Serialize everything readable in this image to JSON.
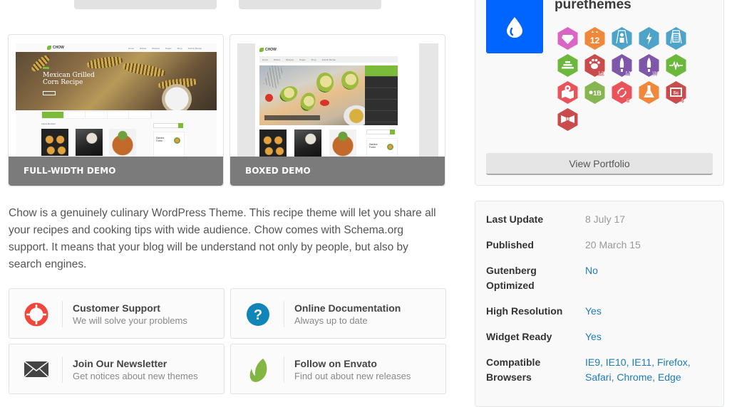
{
  "top_buttons": [
    "",
    ""
  ],
  "demos": [
    {
      "label": "FULL-WIDTH DEMO",
      "thumb": {
        "logo": "CHOW",
        "nav": [
          "Home",
          "Dishes",
          "Recipes",
          "Pages",
          "Shop",
          "Submit Recipe"
        ],
        "hero_title_line1": "Mexican Grilled",
        "hero_title_line2": "Corn Recipe",
        "section_title": "Latest Recipes",
        "author_name_line1": "Sandra",
        "author_name_line2": "Fortin"
      }
    },
    {
      "label": "BOXED DEMO",
      "thumb": {
        "logo": "CHOW",
        "nav": [
          "Home",
          "Dishes",
          "Recipes",
          "Pages",
          "Shop",
          "Submit Recipe"
        ],
        "hero_caption": "Avocado Melon Salad With Lime Vinaigrette",
        "author_name_line1": "Sandra",
        "author_name_line2": "Fortin"
      }
    }
  ],
  "description": "Chow is a genuinely culinary WordPress Theme. This recipe theme will let you share all your recipes and cooking tips with wide audience. Chow comes with Schema.org support. It means that your blog will be understand not only by people, but also by search engines.",
  "features": [
    {
      "title": "Customer Support",
      "subtitle": "We will solve your problems",
      "icon": "lifebuoy-icon",
      "color": "#f2463a"
    },
    {
      "title": "Online Documentation",
      "subtitle": "Always up to date",
      "icon": "question-circle-icon",
      "color": "#0f85b8"
    },
    {
      "title": "Join Our Newsletter",
      "subtitle": "Get notices about new themes",
      "icon": "envelope-icon",
      "color": "#444444"
    },
    {
      "title": "Follow on Envato",
      "subtitle": "Find out about new releases",
      "icon": "envato-leaf-icon",
      "color": "#82b541"
    }
  ],
  "author": {
    "name": "purethemes",
    "avatar_color": "#0065ff",
    "avatar_icon": "water-drop-icon",
    "badges": [
      {
        "name": "diamond-badge",
        "color": "#d966c4",
        "label": ""
      },
      {
        "name": "years-badge",
        "color": "#f0883c",
        "label": "12"
      },
      {
        "name": "author-level-badge",
        "color": "#4ea3c8",
        "label": ""
      },
      {
        "name": "lightning-badge",
        "color": "#4ea3c8",
        "label": ""
      },
      {
        "name": "featured-item-badge",
        "color": "#4ea3c8",
        "label": ""
      },
      {
        "name": "exclusive-badge",
        "color": "#6cb83c",
        "label": ""
      },
      {
        "name": "paw-badge",
        "color": "#c94b4b",
        "label": "12"
      },
      {
        "name": "rocket-m-badge",
        "color": "#7e57a8",
        "label": "M"
      },
      {
        "name": "rocket-w-badge",
        "color": "#7e57a8",
        "label": "W"
      },
      {
        "name": "pulse-badge",
        "color": "#6cb83c",
        "label": ""
      },
      {
        "name": "map-pin-badge",
        "color": "#e8545a",
        "label": ""
      },
      {
        "name": "envato-1b-badge",
        "color": "#86b552",
        "label": "1B"
      },
      {
        "name": "link-badge",
        "color": "#e8545a",
        "label": "6"
      },
      {
        "name": "flask-badge",
        "color": "#f0883c",
        "label": ""
      },
      {
        "name": "sc-badge",
        "color": "#c94b4b",
        "label": "4"
      },
      {
        "name": "bow-badge",
        "color": "#c94b4b",
        "label": ""
      }
    ],
    "portfolio_button": "View Portfolio"
  },
  "meta": [
    {
      "key": "Last Update",
      "value": "8 July 17",
      "link": false
    },
    {
      "key": "Published",
      "value": "20 March 15",
      "link": false
    },
    {
      "key": "Gutenberg Optimized",
      "value": "No",
      "link": true
    },
    {
      "key": "High Resolution",
      "value": "Yes",
      "link": true
    },
    {
      "key": "Widget Ready",
      "value": "Yes",
      "link": true
    },
    {
      "key": "Compatible Browsers",
      "value": "IE9, IE10, IE11, Firefox, Safari, Chrome, Edge",
      "link": true,
      "items": [
        "IE9",
        "IE10",
        "IE11",
        "Firefox",
        "Safari",
        "Chrome",
        "Edge"
      ]
    }
  ]
}
